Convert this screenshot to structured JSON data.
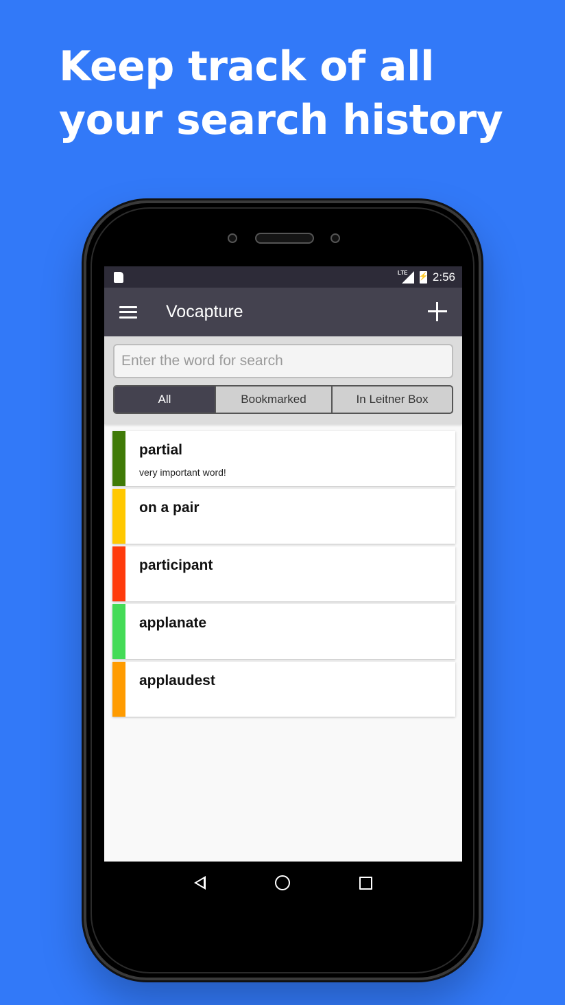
{
  "promo": {
    "headline": "Keep track of all your search history"
  },
  "statusbar": {
    "network": "LTE",
    "time": "2:56"
  },
  "appbar": {
    "title": "Vocapture",
    "menu_icon": "menu-icon",
    "add_icon": "add-icon"
  },
  "search": {
    "placeholder": "Enter the word for search",
    "value": ""
  },
  "filters": {
    "selected": "All",
    "tabs": [
      {
        "label": "All"
      },
      {
        "label": "Bookmarked"
      },
      {
        "label": "In Leitner Box"
      }
    ]
  },
  "words": [
    {
      "word": "partial",
      "note": "very important word!",
      "color": "#3f7a07"
    },
    {
      "word": "on a pair",
      "note": "",
      "color": "#ffc800"
    },
    {
      "word": "participant",
      "note": "",
      "color": "#ff3a0c"
    },
    {
      "word": "applanate",
      "note": "",
      "color": "#44db57"
    },
    {
      "word": "applaudest",
      "note": "",
      "color": "#ff9b00"
    }
  ],
  "colors": {
    "background": "#3279f8",
    "appbar": "#44424f",
    "statusbar": "#2d2b38"
  }
}
